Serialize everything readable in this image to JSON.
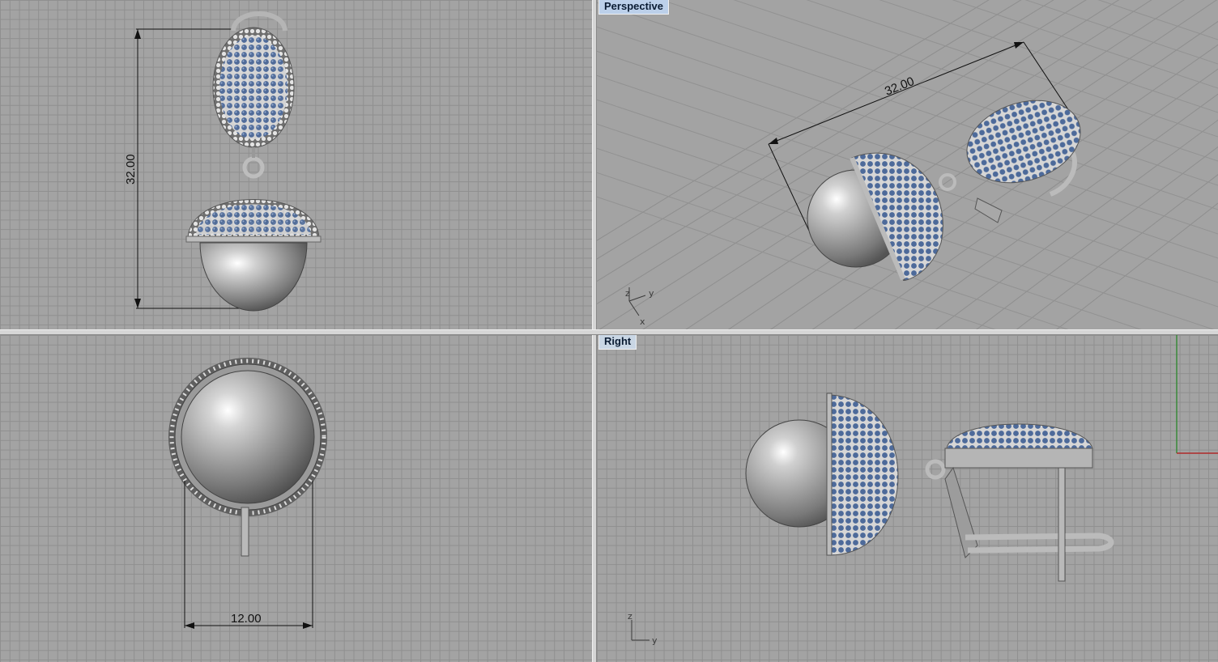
{
  "viewports": {
    "top_left": {
      "title": "",
      "dimension": "32.00"
    },
    "top_right": {
      "title": "Perspective",
      "dimension": "32.00",
      "axes": {
        "z": "z",
        "y": "y",
        "x": "x"
      }
    },
    "bottom_left": {
      "title": "",
      "dimension": "12.00"
    },
    "bottom_right": {
      "title": "Right",
      "axes": {
        "z": "z",
        "y": "y"
      }
    }
  },
  "colors": {
    "viewport_bg": "#a3a3a3",
    "grid_line": "#8f8f8f",
    "metal": "#b8b8b8",
    "gem": "#4d6a9a",
    "label_bg": "#c9d6e4",
    "axis_green": "#3a8a3a",
    "axis_red": "#b02a2a"
  }
}
